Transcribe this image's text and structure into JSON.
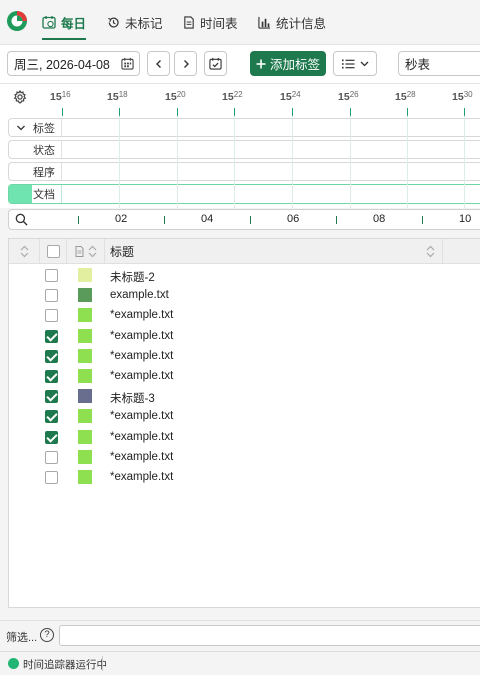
{
  "nav": {
    "tabs": [
      {
        "label": "每日",
        "icon": "calendar-clock-icon",
        "active": true
      },
      {
        "label": "未标记",
        "icon": "history-icon",
        "active": false
      },
      {
        "label": "时间表",
        "icon": "document-icon",
        "active": false
      },
      {
        "label": "统计信息",
        "icon": "bar-chart-icon",
        "active": false
      }
    ]
  },
  "toolbar": {
    "date": "周三, 2026-04-08",
    "add_tag_label": "添加标签",
    "timer_mode": "秒表"
  },
  "ruler": {
    "labels": [
      {
        "hour": "15",
        "min": "16"
      },
      {
        "hour": "15",
        "min": "18"
      },
      {
        "hour": "15",
        "min": "20"
      },
      {
        "hour": "15",
        "min": "22"
      },
      {
        "hour": "15",
        "min": "24"
      },
      {
        "hour": "15",
        "min": "26"
      },
      {
        "hour": "15",
        "min": "28"
      },
      {
        "hour": "15",
        "min": "30"
      }
    ]
  },
  "lanes": [
    {
      "label": "标签"
    },
    {
      "label": "状态"
    },
    {
      "label": "程序"
    },
    {
      "label": "文档"
    }
  ],
  "overview": {
    "labels": [
      "02",
      "04",
      "06",
      "08",
      "10"
    ]
  },
  "table": {
    "column_title": "标题",
    "rows": [
      {
        "checked": false,
        "color": "#e2eea0",
        "title": "未标题-2"
      },
      {
        "checked": false,
        "color": "#5a9a5a",
        "title": "example.txt"
      },
      {
        "checked": false,
        "color": "#8ee050",
        "title": "*example.txt"
      },
      {
        "checked": true,
        "color": "#8ee050",
        "title": "*example.txt"
      },
      {
        "checked": true,
        "color": "#8ee050",
        "title": "*example.txt"
      },
      {
        "checked": true,
        "color": "#8ee050",
        "title": "*example.txt"
      },
      {
        "checked": true,
        "color": "#6a6e8e",
        "title": "未标题-3"
      },
      {
        "checked": true,
        "color": "#8ee050",
        "title": "*example.txt"
      },
      {
        "checked": true,
        "color": "#8ee050",
        "title": "*example.txt"
      },
      {
        "checked": false,
        "color": "#8ee050",
        "title": "*example.txt"
      },
      {
        "checked": false,
        "color": "#8ee050",
        "title": "*example.txt"
      }
    ]
  },
  "filter": {
    "label": "筛选...",
    "help": "?",
    "value": ""
  },
  "status": {
    "text": "时间追踪器运行中",
    "color": "#22b573"
  },
  "accent": "#1e7a4e"
}
